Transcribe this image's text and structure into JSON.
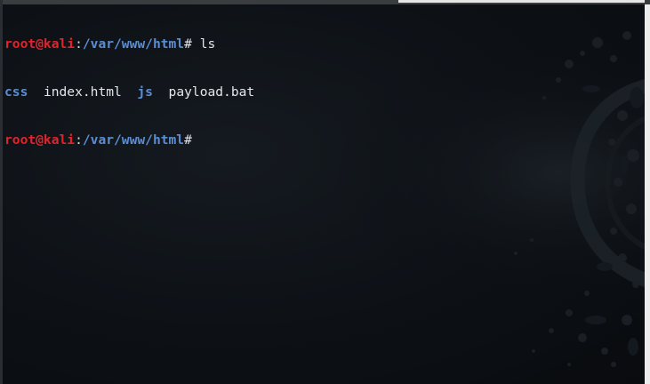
{
  "terminal": {
    "user_host": "root@kali",
    "separator": ":",
    "cwd": "/var/www/html",
    "prompt_symbol": "#",
    "lines": [
      {
        "command": " ls"
      },
      {
        "entries": [
          {
            "name": "css",
            "type": "directory"
          },
          {
            "name": "index.html",
            "type": "file"
          },
          {
            "name": "js",
            "type": "directory"
          },
          {
            "name": "payload.bat",
            "type": "file"
          }
        ]
      },
      {
        "command": ""
      }
    ]
  },
  "colors": {
    "user_host": "#e0242a",
    "path": "#5a8ed2",
    "text": "#e3e6ea",
    "background": "#0b0e12"
  }
}
